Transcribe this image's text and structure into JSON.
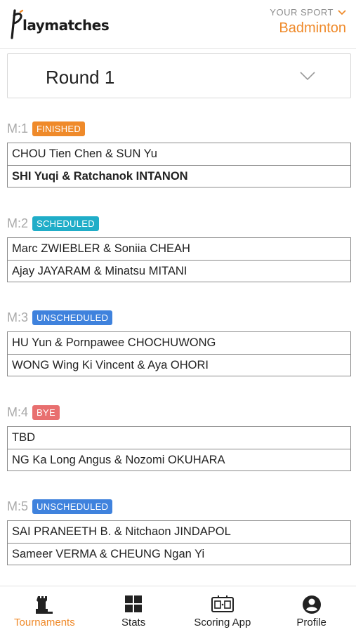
{
  "header": {
    "logo_text": "laymatches",
    "sport_caption": "YOUR SPORT",
    "sport_value": "Badminton"
  },
  "round_selector": {
    "label": "Round 1"
  },
  "matches": [
    {
      "number": "M:1",
      "status": "FINISHED",
      "status_color": "#ef8a2a",
      "teams": [
        "CHOU Tien Chen & SUN Yu",
        "SHI Yuqi & Ratchanok INTANON"
      ],
      "winner_index": 1
    },
    {
      "number": "M:2",
      "status": "SCHEDULED",
      "status_color": "#20adc8",
      "teams": [
        "Marc ZWIEBLER & Soniia CHEAH",
        "Ajay JAYARAM & Minatsu MITANI"
      ],
      "winner_index": -1
    },
    {
      "number": "M:3",
      "status": "UNSCHEDULED",
      "status_color": "#3f82dd",
      "teams": [
        "HU Yun & Pornpawee CHOCHUWONG",
        "WONG Wing Ki Vincent & Aya OHORI"
      ],
      "winner_index": -1
    },
    {
      "number": "M:4",
      "status": "BYE",
      "status_color": "#e86f6f",
      "teams": [
        "TBD",
        "NG Ka Long Angus & Nozomi OKUHARA"
      ],
      "winner_index": -1
    },
    {
      "number": "M:5",
      "status": "UNSCHEDULED",
      "status_color": "#3f82dd",
      "teams": [
        "SAI PRANEETH B. & Nitchaon JINDAPOL",
        "Sameer VERMA & CHEUNG Ngan Yi"
      ],
      "winner_index": -1
    }
  ],
  "bottom_nav": [
    {
      "label": "Tournaments",
      "icon": "chess-castle-icon",
      "active": true
    },
    {
      "label": "Stats",
      "icon": "grid-icon",
      "active": false
    },
    {
      "label": "Scoring App",
      "icon": "scoreboard-icon",
      "active": false
    },
    {
      "label": "Profile",
      "icon": "user-circle-icon",
      "active": false
    }
  ],
  "colors": {
    "accent": "#ef8a2a"
  }
}
